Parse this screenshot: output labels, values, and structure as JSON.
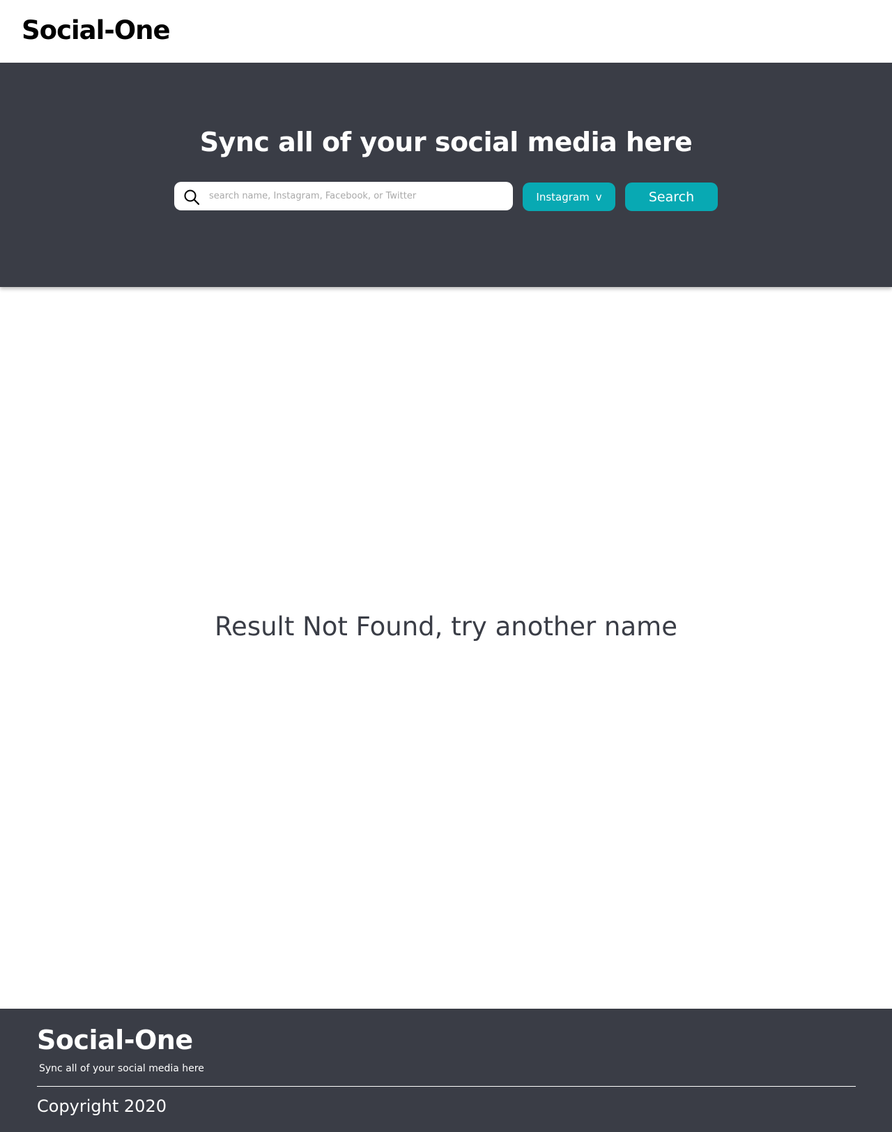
{
  "navbar": {
    "logo": "Social-One"
  },
  "hero": {
    "title": "Sync all of your social media here",
    "search": {
      "placeholder": "search name, Instagram, Facebook, or Twitter",
      "value": ""
    },
    "platform_select": {
      "label": "Instagram",
      "caret": "v"
    },
    "search_button": "Search"
  },
  "main": {
    "message": "Result Not Found, try another name"
  },
  "footer": {
    "logo": "Social-One",
    "tagline": "Sync all of your social media here",
    "copyright": "Copyright 2020"
  },
  "colors": {
    "accent": "#08a9b3",
    "dark": "#3a3d46",
    "background": "#ffffff"
  },
  "icons": {
    "search": "search-icon"
  }
}
